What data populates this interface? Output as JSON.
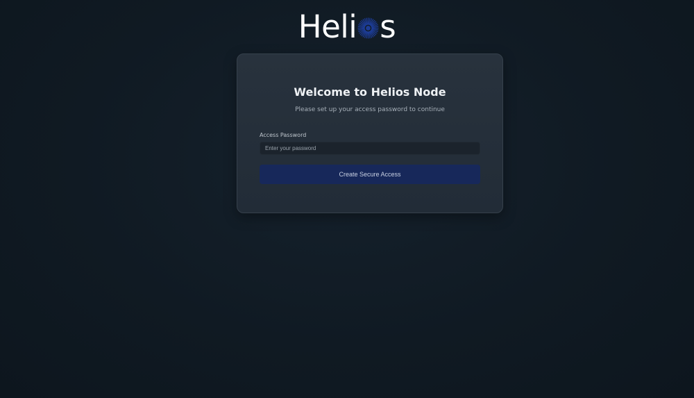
{
  "brand": {
    "name_prefix": "Heli",
    "name_suffix": "s",
    "logo_o_icon": "sunburst-icon",
    "logo_o_color": "#1d3c96"
  },
  "card": {
    "title": "Welcome to Helios Node",
    "subtitle": "Please set up your access password to continue",
    "password_label": "Access Password",
    "password_placeholder": "Enter your password",
    "password_value": "",
    "submit_label": "Create Secure Access"
  },
  "colors": {
    "background": "#111b24",
    "card_background": "#252f3a",
    "button_background": "#17285a"
  }
}
